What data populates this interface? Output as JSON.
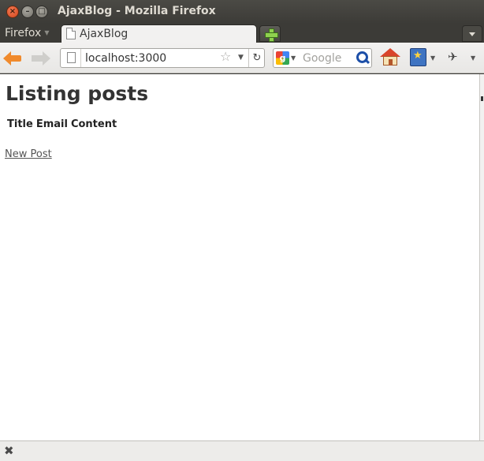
{
  "window": {
    "title": "AjaxBlog - Mozilla Firefox"
  },
  "menu": {
    "app_label": "Firefox"
  },
  "tabs": [
    {
      "label": "AjaxBlog"
    }
  ],
  "navbar": {
    "url": "localhost:3000",
    "search_placeholder": "Google",
    "reload_glyph": "↻"
  },
  "page": {
    "heading": "Listing posts",
    "table": {
      "columns": [
        "Title",
        "Email",
        "Content"
      ],
      "rows": []
    },
    "new_post_link": "New Post"
  },
  "icons": {
    "close": "close-icon",
    "minimize": "minimize-icon",
    "maximize": "maximize-icon",
    "back": "back-arrow-icon",
    "forward": "forward-arrow-icon",
    "bookmark_star": "star-icon",
    "search_engine": "google-icon",
    "search": "magnifier-icon",
    "home": "home-icon",
    "bookmarks": "bookmarks-icon",
    "addon": "addon-icon",
    "close_find": "close-icon"
  },
  "colors": {
    "titlebar": "#3c3b37",
    "close_button": "#e05b31",
    "back_arrow": "#f08a2c"
  }
}
